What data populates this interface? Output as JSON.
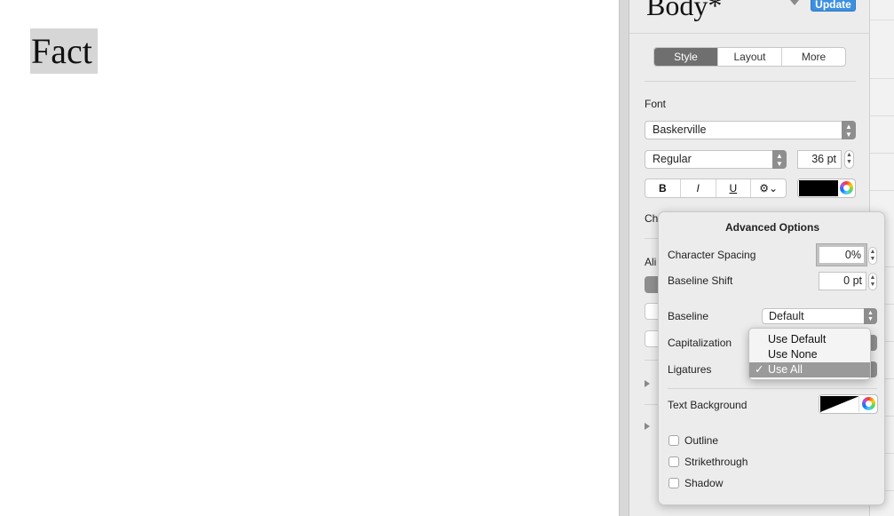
{
  "document": {
    "text": "Fact"
  },
  "inspector": {
    "style_name": "Body*",
    "update_label": "Update",
    "tabs": [
      {
        "label": "Style",
        "active": true
      },
      {
        "label": "Layout",
        "active": false
      },
      {
        "label": "More",
        "active": false
      }
    ],
    "font_section_label": "Font",
    "font_family": "Baskerville",
    "font_typeface": "Regular",
    "font_size": "36 pt",
    "format_buttons": {
      "bold": "B",
      "italic": "I",
      "underline": "U",
      "gear": "⚙⌄"
    },
    "text_color": "#000000",
    "partial_labels": {
      "character_styles": "Ch",
      "alignment": "Ali"
    }
  },
  "advanced_options": {
    "title": "Advanced Options",
    "character_spacing_label": "Character Spacing",
    "character_spacing_value": "0%",
    "baseline_shift_label": "Baseline Shift",
    "baseline_shift_value": "0 pt",
    "baseline_label": "Baseline",
    "baseline_value": "Default",
    "capitalization_label": "Capitalization",
    "ligatures_label": "Ligatures",
    "ligatures_menu": {
      "options": [
        "Use Default",
        "Use None",
        "Use All"
      ],
      "selected": "Use All",
      "check": "✓"
    },
    "text_background_label": "Text Background",
    "checkboxes": [
      {
        "label": "Outline",
        "checked": false
      },
      {
        "label": "Strikethrough",
        "checked": false
      },
      {
        "label": "Shadow",
        "checked": false
      }
    ]
  },
  "icons": {
    "stepper": "stepper-arrows-icon",
    "color_wheel": "color-wheel-icon",
    "disclosure": "disclosure-triangle-icon",
    "checkmark": "checkmark-icon"
  },
  "colors": {
    "accent": "#3d8fe0",
    "segment_active": "#6f6f6f",
    "menu_highlight": "#9a9a9a"
  }
}
